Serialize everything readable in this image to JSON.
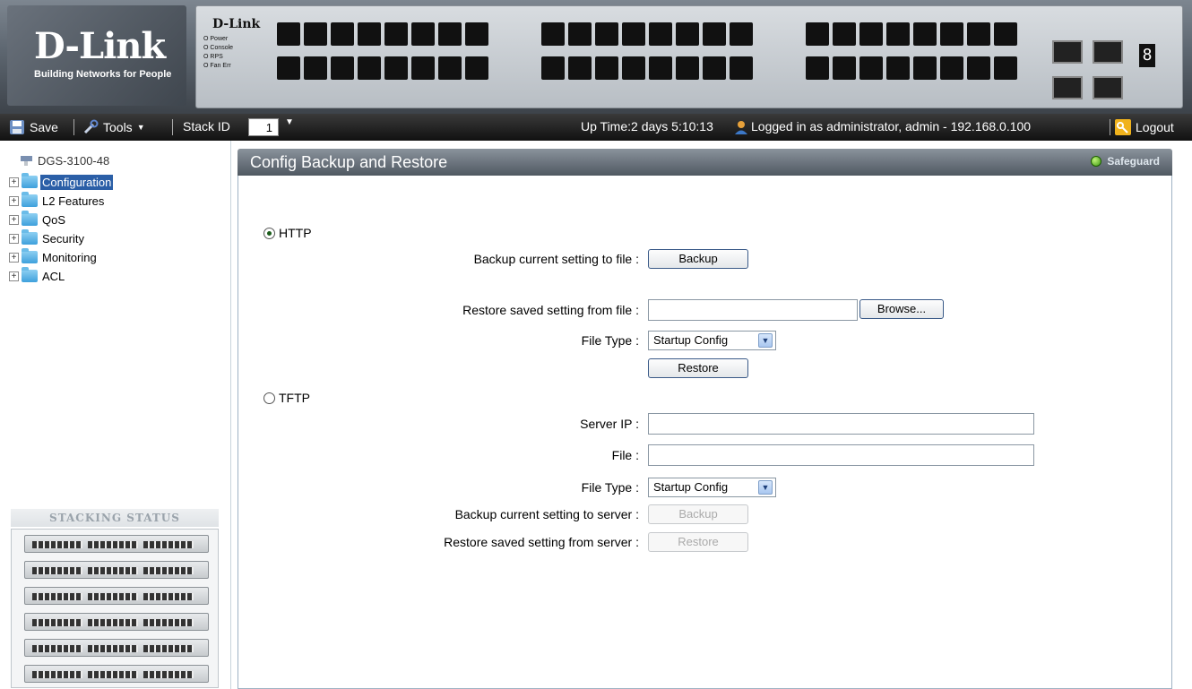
{
  "banner": {
    "logo": "D-Link",
    "tagline": "Building Networks for People",
    "panel_brand": "D-Link",
    "panel_leds": [
      "O Power",
      "O Console",
      "O RPS",
      "O Fan Err"
    ],
    "seven_segment": "8"
  },
  "toolbar": {
    "save_label": "Save",
    "tools_label": "Tools",
    "stack_id_label": "Stack ID",
    "stack_id_value": "1",
    "uptime": "Up Time:2 days 5:10:13",
    "login_info": "Logged in as administrator, admin - 192.168.0.100",
    "logout_label": "Logout"
  },
  "tree": {
    "root": "DGS-3100-48",
    "items": [
      {
        "label": "Configuration",
        "selected": true
      },
      {
        "label": "L2 Features",
        "selected": false
      },
      {
        "label": "QoS",
        "selected": false
      },
      {
        "label": "Security",
        "selected": false
      },
      {
        "label": "Monitoring",
        "selected": false
      },
      {
        "label": "ACL",
        "selected": false
      }
    ]
  },
  "stacking": {
    "title": "Stacking Status",
    "unit_count": 6
  },
  "main": {
    "title": "Config Backup and Restore",
    "safeguard": "Safeguard",
    "http": {
      "label": "HTTP",
      "selected": true,
      "backup_label": "Backup current setting to file :",
      "backup_button": "Backup",
      "restore_label": "Restore saved setting from file :",
      "restore_file_value": "",
      "browse_button": "Browse...",
      "file_type_label": "File Type :",
      "file_type_value": "Startup Config",
      "restore_button": "Restore"
    },
    "tftp": {
      "label": "TFTP",
      "selected": false,
      "server_ip_label": "Server IP :",
      "server_ip_value": "",
      "file_label": "File :",
      "file_value": "",
      "file_type_label": "File Type :",
      "file_type_value": "Startup Config",
      "backup_label": "Backup current setting to server :",
      "backup_button": "Backup",
      "restore_label": "Restore saved setting from server :",
      "restore_button": "Restore"
    }
  },
  "colors": {
    "selected_tree": "#2b5fa7",
    "header_bg": "#4f5861",
    "toolbar_bg": "#111111"
  }
}
